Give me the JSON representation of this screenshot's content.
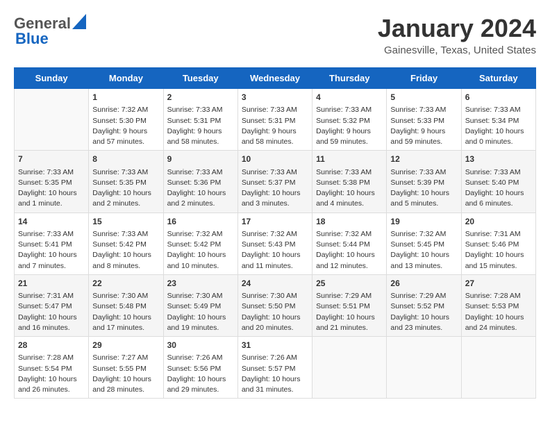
{
  "header": {
    "logo_general": "General",
    "logo_blue": "Blue",
    "month_title": "January 2024",
    "location": "Gainesville, Texas, United States"
  },
  "days_of_week": [
    "Sunday",
    "Monday",
    "Tuesday",
    "Wednesday",
    "Thursday",
    "Friday",
    "Saturday"
  ],
  "weeks": [
    [
      {
        "day": "",
        "info": ""
      },
      {
        "day": "1",
        "info": "Sunrise: 7:32 AM\nSunset: 5:30 PM\nDaylight: 9 hours\nand 57 minutes."
      },
      {
        "day": "2",
        "info": "Sunrise: 7:33 AM\nSunset: 5:31 PM\nDaylight: 9 hours\nand 58 minutes."
      },
      {
        "day": "3",
        "info": "Sunrise: 7:33 AM\nSunset: 5:31 PM\nDaylight: 9 hours\nand 58 minutes."
      },
      {
        "day": "4",
        "info": "Sunrise: 7:33 AM\nSunset: 5:32 PM\nDaylight: 9 hours\nand 59 minutes."
      },
      {
        "day": "5",
        "info": "Sunrise: 7:33 AM\nSunset: 5:33 PM\nDaylight: 9 hours\nand 59 minutes."
      },
      {
        "day": "6",
        "info": "Sunrise: 7:33 AM\nSunset: 5:34 PM\nDaylight: 10 hours\nand 0 minutes."
      }
    ],
    [
      {
        "day": "7",
        "info": "Sunrise: 7:33 AM\nSunset: 5:35 PM\nDaylight: 10 hours\nand 1 minute."
      },
      {
        "day": "8",
        "info": "Sunrise: 7:33 AM\nSunset: 5:35 PM\nDaylight: 10 hours\nand 2 minutes."
      },
      {
        "day": "9",
        "info": "Sunrise: 7:33 AM\nSunset: 5:36 PM\nDaylight: 10 hours\nand 2 minutes."
      },
      {
        "day": "10",
        "info": "Sunrise: 7:33 AM\nSunset: 5:37 PM\nDaylight: 10 hours\nand 3 minutes."
      },
      {
        "day": "11",
        "info": "Sunrise: 7:33 AM\nSunset: 5:38 PM\nDaylight: 10 hours\nand 4 minutes."
      },
      {
        "day": "12",
        "info": "Sunrise: 7:33 AM\nSunset: 5:39 PM\nDaylight: 10 hours\nand 5 minutes."
      },
      {
        "day": "13",
        "info": "Sunrise: 7:33 AM\nSunset: 5:40 PM\nDaylight: 10 hours\nand 6 minutes."
      }
    ],
    [
      {
        "day": "14",
        "info": "Sunrise: 7:33 AM\nSunset: 5:41 PM\nDaylight: 10 hours\nand 7 minutes."
      },
      {
        "day": "15",
        "info": "Sunrise: 7:33 AM\nSunset: 5:42 PM\nDaylight: 10 hours\nand 8 minutes."
      },
      {
        "day": "16",
        "info": "Sunrise: 7:32 AM\nSunset: 5:42 PM\nDaylight: 10 hours\nand 10 minutes."
      },
      {
        "day": "17",
        "info": "Sunrise: 7:32 AM\nSunset: 5:43 PM\nDaylight: 10 hours\nand 11 minutes."
      },
      {
        "day": "18",
        "info": "Sunrise: 7:32 AM\nSunset: 5:44 PM\nDaylight: 10 hours\nand 12 minutes."
      },
      {
        "day": "19",
        "info": "Sunrise: 7:32 AM\nSunset: 5:45 PM\nDaylight: 10 hours\nand 13 minutes."
      },
      {
        "day": "20",
        "info": "Sunrise: 7:31 AM\nSunset: 5:46 PM\nDaylight: 10 hours\nand 15 minutes."
      }
    ],
    [
      {
        "day": "21",
        "info": "Sunrise: 7:31 AM\nSunset: 5:47 PM\nDaylight: 10 hours\nand 16 minutes."
      },
      {
        "day": "22",
        "info": "Sunrise: 7:30 AM\nSunset: 5:48 PM\nDaylight: 10 hours\nand 17 minutes."
      },
      {
        "day": "23",
        "info": "Sunrise: 7:30 AM\nSunset: 5:49 PM\nDaylight: 10 hours\nand 19 minutes."
      },
      {
        "day": "24",
        "info": "Sunrise: 7:30 AM\nSunset: 5:50 PM\nDaylight: 10 hours\nand 20 minutes."
      },
      {
        "day": "25",
        "info": "Sunrise: 7:29 AM\nSunset: 5:51 PM\nDaylight: 10 hours\nand 21 minutes."
      },
      {
        "day": "26",
        "info": "Sunrise: 7:29 AM\nSunset: 5:52 PM\nDaylight: 10 hours\nand 23 minutes."
      },
      {
        "day": "27",
        "info": "Sunrise: 7:28 AM\nSunset: 5:53 PM\nDaylight: 10 hours\nand 24 minutes."
      }
    ],
    [
      {
        "day": "28",
        "info": "Sunrise: 7:28 AM\nSunset: 5:54 PM\nDaylight: 10 hours\nand 26 minutes."
      },
      {
        "day": "29",
        "info": "Sunrise: 7:27 AM\nSunset: 5:55 PM\nDaylight: 10 hours\nand 28 minutes."
      },
      {
        "day": "30",
        "info": "Sunrise: 7:26 AM\nSunset: 5:56 PM\nDaylight: 10 hours\nand 29 minutes."
      },
      {
        "day": "31",
        "info": "Sunrise: 7:26 AM\nSunset: 5:57 PM\nDaylight: 10 hours\nand 31 minutes."
      },
      {
        "day": "",
        "info": ""
      },
      {
        "day": "",
        "info": ""
      },
      {
        "day": "",
        "info": ""
      }
    ]
  ]
}
